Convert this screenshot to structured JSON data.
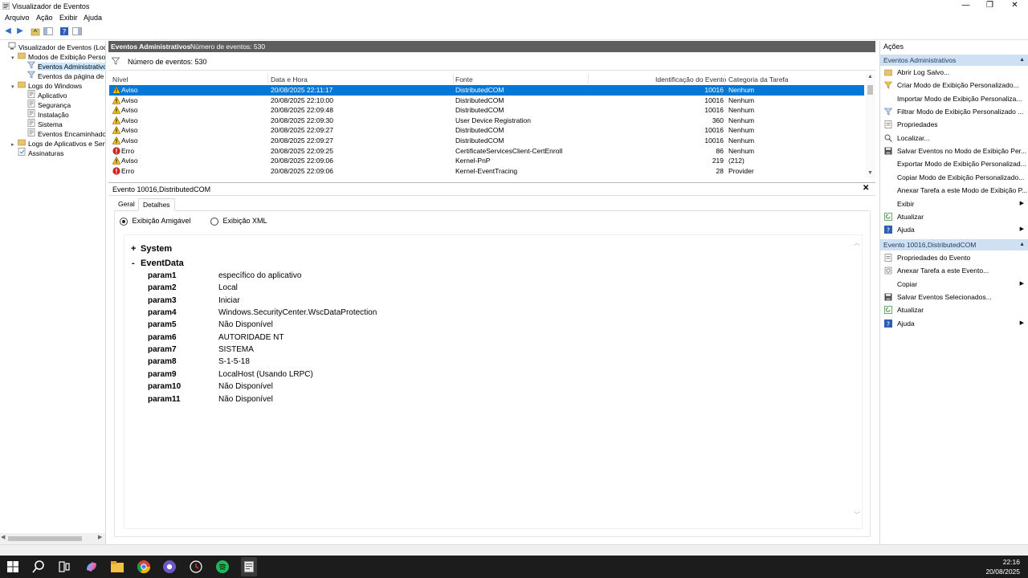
{
  "window": {
    "title": "Visualizador de Eventos"
  },
  "menu": [
    "Arquivo",
    "Ação",
    "Exibir",
    "Ajuda"
  ],
  "tree": [
    {
      "label": "Visualizador de Eventos (Local)",
      "indent": 0,
      "exp": "",
      "icon": "computer-icon"
    },
    {
      "label": "Modos de Exibição Personali",
      "indent": 1,
      "exp": "▾",
      "icon": "folder-icon"
    },
    {
      "label": "Eventos Administrativos",
      "indent": 2,
      "exp": "",
      "icon": "filter-icon",
      "selected": true
    },
    {
      "label": "Eventos da página de res",
      "indent": 2,
      "exp": "",
      "icon": "filter-icon"
    },
    {
      "label": "Logs do Windows",
      "indent": 1,
      "exp": "▾",
      "icon": "folder-icon"
    },
    {
      "label": "Aplicativo",
      "indent": 2,
      "exp": "",
      "icon": "log-icon"
    },
    {
      "label": "Segurança",
      "indent": 2,
      "exp": "",
      "icon": "log-icon"
    },
    {
      "label": "Instalação",
      "indent": 2,
      "exp": "",
      "icon": "log-icon"
    },
    {
      "label": "Sistema",
      "indent": 2,
      "exp": "",
      "icon": "log-icon"
    },
    {
      "label": "Eventos Encaminhados",
      "indent": 2,
      "exp": "",
      "icon": "log-icon"
    },
    {
      "label": "Logs de Aplicativos e Serviço",
      "indent": 1,
      "exp": "▸",
      "icon": "folder-icon"
    },
    {
      "label": "Assinaturas",
      "indent": 1,
      "exp": "",
      "icon": "subscription-icon"
    }
  ],
  "center": {
    "title": "Eventos Administrativos",
    "count_header": "Número de eventos: 530",
    "filter_text": "Número de eventos: 530",
    "columns": [
      "Nível",
      "Data e Hora",
      "Fonte",
      "Identificação do Evento",
      "Categoria da Tarefa"
    ],
    "rows": [
      {
        "level": "Aviso",
        "date": "20/08/2025 22:11:17",
        "source": "DistributedCOM",
        "id": "10016",
        "cat": "Nenhum",
        "selected": true
      },
      {
        "level": "Aviso",
        "date": "20/08/2025 22:10:00",
        "source": "DistributedCOM",
        "id": "10016",
        "cat": "Nenhum"
      },
      {
        "level": "Aviso",
        "date": "20/08/2025 22:09:48",
        "source": "DistributedCOM",
        "id": "10016",
        "cat": "Nenhum"
      },
      {
        "level": "Aviso",
        "date": "20/08/2025 22:09:30",
        "source": "User Device Registration",
        "id": "360",
        "cat": "Nenhum"
      },
      {
        "level": "Aviso",
        "date": "20/08/2025 22:09:27",
        "source": "DistributedCOM",
        "id": "10016",
        "cat": "Nenhum"
      },
      {
        "level": "Aviso",
        "date": "20/08/2025 22:09:27",
        "source": "DistributedCOM",
        "id": "10016",
        "cat": "Nenhum"
      },
      {
        "level": "Erro",
        "date": "20/08/2025 22:09:25",
        "source": "CertificateServicesClient-CertEnroll",
        "id": "86",
        "cat": "Nenhum"
      },
      {
        "level": "Aviso",
        "date": "20/08/2025 22:09:06",
        "source": "Kernel-PnP",
        "id": "219",
        "cat": "(212)"
      },
      {
        "level": "Erro",
        "date": "20/08/2025 22:09:06",
        "source": "Kernel-EventTracing",
        "id": "28",
        "cat": "Provider"
      }
    ]
  },
  "detail": {
    "title": "Evento 10016,DistributedCOM",
    "tabs": [
      "Geral",
      "Detalhes"
    ],
    "active_tab": "Detalhes",
    "radio_friendly": "Exibição Amigável",
    "radio_xml": "Exibição XML",
    "section_system": "System",
    "section_eventdata": "EventData",
    "params": [
      {
        "name": "param1",
        "value": "específico do aplicativo"
      },
      {
        "name": "param2",
        "value": "Local"
      },
      {
        "name": "param3",
        "value": "Iniciar"
      },
      {
        "name": "param4",
        "value": "Windows.SecurityCenter.WscDataProtection"
      },
      {
        "name": "param5",
        "value": "Não Disponível"
      },
      {
        "name": "param6",
        "value": "AUTORIDADE NT"
      },
      {
        "name": "param7",
        "value": "SISTEMA"
      },
      {
        "name": "param8",
        "value": "S-1-5-18"
      },
      {
        "name": "param9",
        "value": "LocalHost (Usando LRPC)"
      },
      {
        "name": "param10",
        "value": "Não Disponível"
      },
      {
        "name": "param11",
        "value": "Não Disponível"
      }
    ]
  },
  "actions": {
    "title": "Ações",
    "section1": "Eventos Administrativos",
    "items1": [
      {
        "label": "Abrir Log Salvo...",
        "icon": "open-log-icon"
      },
      {
        "label": "Criar Modo de Exibição Personalizado...",
        "icon": "filter-create-icon"
      },
      {
        "label": "Importar Modo de Exibição Personaliza...",
        "icon": "blank-icon"
      },
      {
        "label": "Filtrar Modo de Exibição Personalizado ...",
        "icon": "filter-icon"
      },
      {
        "label": "Propriedades",
        "icon": "properties-icon"
      },
      {
        "label": "Localizar...",
        "icon": "find-icon"
      },
      {
        "label": "Salvar Eventos no Modo de Exibição Per...",
        "icon": "save-icon"
      },
      {
        "label": "Exportar Modo de Exibição Personalizad...",
        "icon": "blank-icon"
      },
      {
        "label": "Copiar Modo de Exibição Personalizado...",
        "icon": "blank-icon"
      },
      {
        "label": "Anexar Tarefa a este Modo de Exibição P...",
        "icon": "blank-icon"
      },
      {
        "label": "Exibir",
        "icon": "blank-icon",
        "submenu": true
      },
      {
        "label": "Atualizar",
        "icon": "refresh-icon"
      },
      {
        "label": "Ajuda",
        "icon": "help-icon",
        "submenu": true
      }
    ],
    "section2": "Evento 10016,DistributedCOM",
    "items2": [
      {
        "label": "Propriedades do Evento",
        "icon": "properties-icon"
      },
      {
        "label": "Anexar Tarefa a este Evento...",
        "icon": "task-icon"
      },
      {
        "label": "Copiar",
        "icon": "copy-icon",
        "submenu": true
      },
      {
        "label": "Salvar Eventos Selecionados...",
        "icon": "save-icon"
      },
      {
        "label": "Atualizar",
        "icon": "refresh-icon"
      },
      {
        "label": "Ajuda",
        "icon": "help-icon",
        "submenu": true
      }
    ]
  },
  "taskbar": {
    "time": "22:16",
    "date": "20/08/2025"
  },
  "colors": {
    "selection": "#0078d7",
    "section": "#cfe0f2",
    "header": "#5e5e5e"
  }
}
